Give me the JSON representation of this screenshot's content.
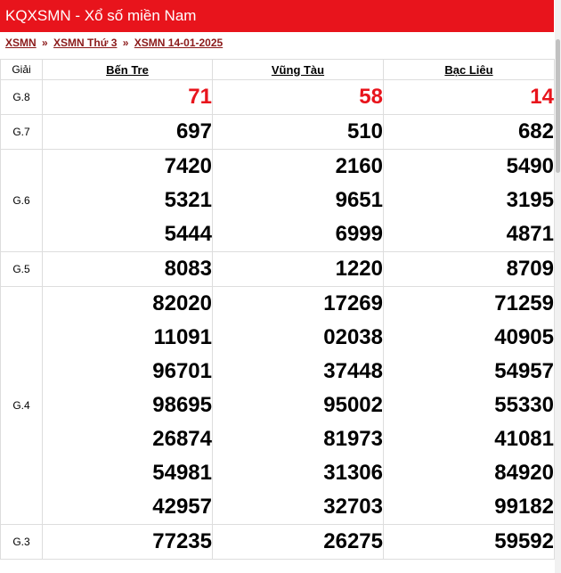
{
  "header": {
    "title": "KQXSMN - Xổ số miền Nam"
  },
  "breadcrumb": {
    "items": [
      "XSMN",
      "XSMN Thứ 3",
      "XSMN 14-01-2025"
    ],
    "separator": "»"
  },
  "table": {
    "prize_header": "Giải",
    "provinces": [
      "Bến Tre",
      "Vũng Tàu",
      "Bạc Liêu"
    ],
    "rows": [
      {
        "prize": "G.8",
        "values": [
          [
            "71"
          ],
          [
            "58"
          ],
          [
            "14"
          ]
        ]
      },
      {
        "prize": "G.7",
        "values": [
          [
            "697"
          ],
          [
            "510"
          ],
          [
            "682"
          ]
        ]
      },
      {
        "prize": "G.6",
        "values": [
          [
            "7420",
            "5321",
            "5444"
          ],
          [
            "2160",
            "9651",
            "6999"
          ],
          [
            "5490",
            "3195",
            "4871"
          ]
        ]
      },
      {
        "prize": "G.5",
        "values": [
          [
            "8083"
          ],
          [
            "1220"
          ],
          [
            "8709"
          ]
        ]
      },
      {
        "prize": "G.4",
        "values": [
          [
            "82020",
            "11091",
            "96701",
            "98695",
            "26874",
            "54981",
            "42957"
          ],
          [
            "17269",
            "02038",
            "37448",
            "95002",
            "81973",
            "31306",
            "32703"
          ],
          [
            "71259",
            "40905",
            "54957",
            "55330",
            "41081",
            "84920",
            "99182"
          ]
        ]
      },
      {
        "prize": "G.3",
        "values": [
          [
            "77235"
          ],
          [
            "26275"
          ],
          [
            "59592"
          ]
        ]
      }
    ]
  },
  "colors": {
    "accent": "#e8141c",
    "breadcrumb": "#8b1a1a"
  }
}
